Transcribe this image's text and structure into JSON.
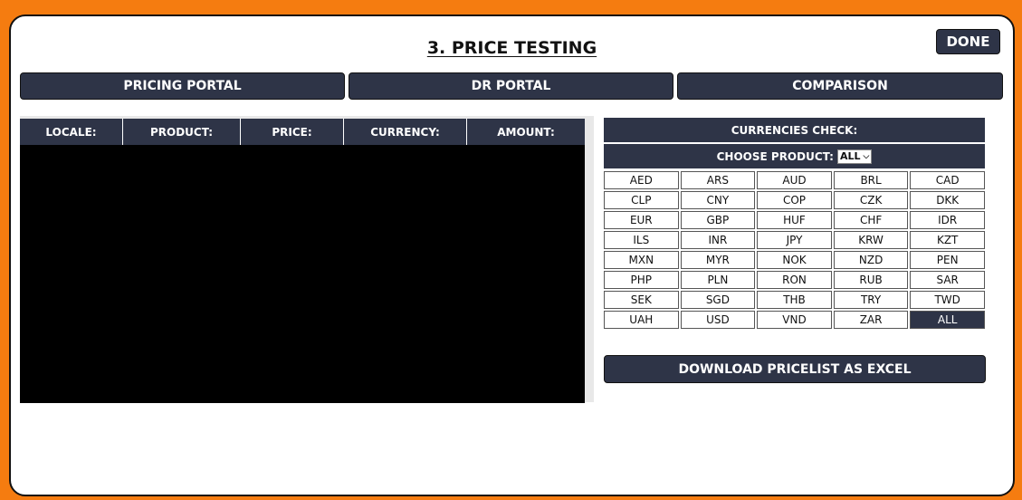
{
  "page": {
    "title": "3. PRICE TESTING",
    "done_label": "DONE"
  },
  "tabs": [
    {
      "label": "PRICING PORTAL"
    },
    {
      "label": "DR PORTAL"
    },
    {
      "label": "COMPARISON"
    }
  ],
  "table": {
    "columns": [
      "LOCALE:",
      "PRODUCT:",
      "PRICE:",
      "CURRENCY:",
      "AMOUNT:"
    ]
  },
  "currencies": {
    "title": "CURRENCIES CHECK:",
    "choose_label": "CHOOSE PRODUCT:",
    "product_selected": "ALL",
    "codes": [
      "AED",
      "ARS",
      "AUD",
      "BRL",
      "CAD",
      "CLP",
      "CNY",
      "COP",
      "CZK",
      "DKK",
      "EUR",
      "GBP",
      "HUF",
      "CHF",
      "IDR",
      "ILS",
      "INR",
      "JPY",
      "KRW",
      "KZT",
      "MXN",
      "MYR",
      "NOK",
      "NZD",
      "PEN",
      "PHP",
      "PLN",
      "RON",
      "RUB",
      "SAR",
      "SEK",
      "SGD",
      "THB",
      "TRY",
      "TWD",
      "UAH",
      "USD",
      "VND",
      "ZAR",
      "ALL"
    ],
    "active": "ALL"
  },
  "download_label": "DOWNLOAD PRICELIST AS EXCEL",
  "colors": {
    "frame": "#f57c10",
    "navy": "#2e3447"
  }
}
